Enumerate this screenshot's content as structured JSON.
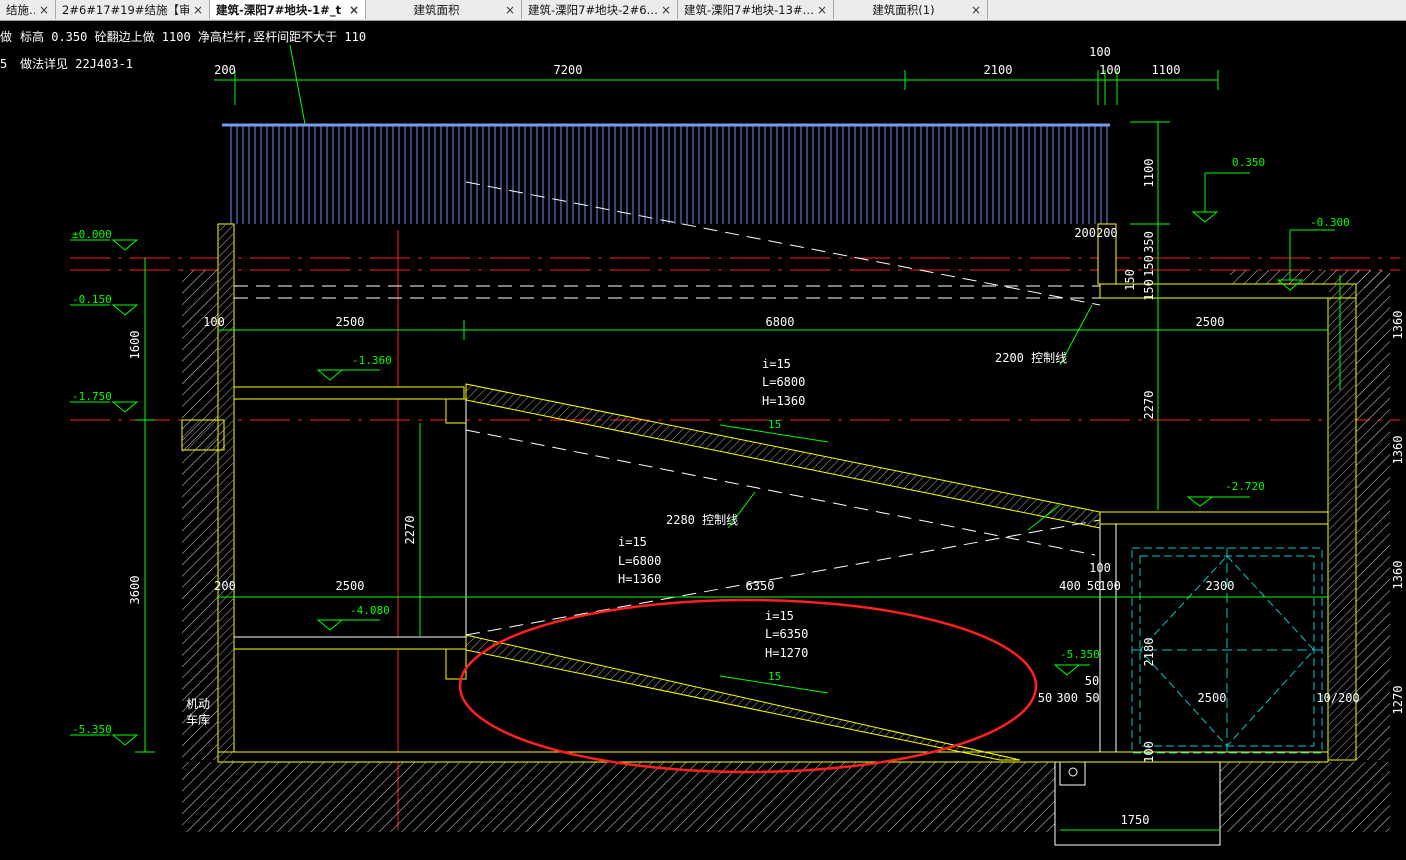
{
  "tabs": [
    {
      "label": "结施…",
      "active": false
    },
    {
      "label": "2#6#17#19#结施【审…",
      "active": false
    },
    {
      "label": "建筑-溧阳7#地块-1#_t",
      "active": true
    },
    {
      "label": "建筑面积",
      "active": false
    },
    {
      "label": "建筑-溧阳7#地块-2#6…",
      "active": false
    },
    {
      "label": "建筑-溧阳7#地块-13#…",
      "active": false
    },
    {
      "label": "建筑面积(1)",
      "active": false
    }
  ],
  "tab_close_glyph": "×",
  "notes": {
    "line1": "标高 0.350 砼翻边上做  1100 净高栏杆,竖杆间距不大于     110",
    "line2": "做法详见  22J403-1",
    "side_a": "做",
    "side_b": "5"
  },
  "dims_top": {
    "d200": "200",
    "d7200": "7200",
    "d2100": "2100",
    "d100a": "100",
    "d100b": "100",
    "d1100": "1100"
  },
  "dims_mid": {
    "d100": "100",
    "d2500a": "2500",
    "d6800": "6800",
    "d2500b": "2500",
    "d200_200": "200200"
  },
  "dims_low": {
    "d200": "200",
    "d2500": "2500",
    "d6350": "6350",
    "d400": "400",
    "d50a": "50",
    "d100a": "100",
    "d100b": "100",
    "d2300": "2300",
    "d10_200": "10/200",
    "d50b": "50",
    "d300_50": "300 50",
    "d50c": "50",
    "d1750": "1750",
    "d2180": "2180",
    "d100v": "100"
  },
  "dims_vertical": {
    "v1100": "1100",
    "v350": "350",
    "v150a": "150",
    "v150b": "150",
    "v150c": "150",
    "v1600": "1600",
    "v3600": "3600",
    "v2270a": "2270",
    "v2270b": "2270",
    "vr1360a": "1360",
    "vr1360b": "1360",
    "vr1360c": "1360",
    "vr1270": "1270"
  },
  "levels": {
    "l0": "±0.000",
    "l_150": "-0.150",
    "l_1750": "-1.750",
    "l_5350": "-5.350",
    "l_1360": "-1.360",
    "l_4080": "-4.080",
    "l_2720": "-2.720",
    "l_0350": "0.350",
    "l_0300": "-0.300",
    "l_5350b": "-5.350"
  },
  "ramp1": {
    "i": "i=15",
    "L": "L=6800",
    "H": "H=1360",
    "slope": "15"
  },
  "ramp2": {
    "i": "i=15",
    "L": "L=6800",
    "H": "H=1360"
  },
  "ramp3": {
    "i": "i=15",
    "L": "L=6350",
    "H": "H=1270",
    "slope": "15"
  },
  "control_lines": {
    "c2200": "2200 控制线",
    "c2280": "2280 控制线"
  },
  "room_label": {
    "a": "机动",
    "b": "车库"
  },
  "colors": {
    "line": "#ffffff",
    "dim": "#00ff00",
    "text": "#ffffff",
    "wall": "#ffff00",
    "axis": "#ff0000",
    "rail": "#5d7ee0",
    "cyan": "#00c8c8",
    "circle": "#ff2020"
  }
}
